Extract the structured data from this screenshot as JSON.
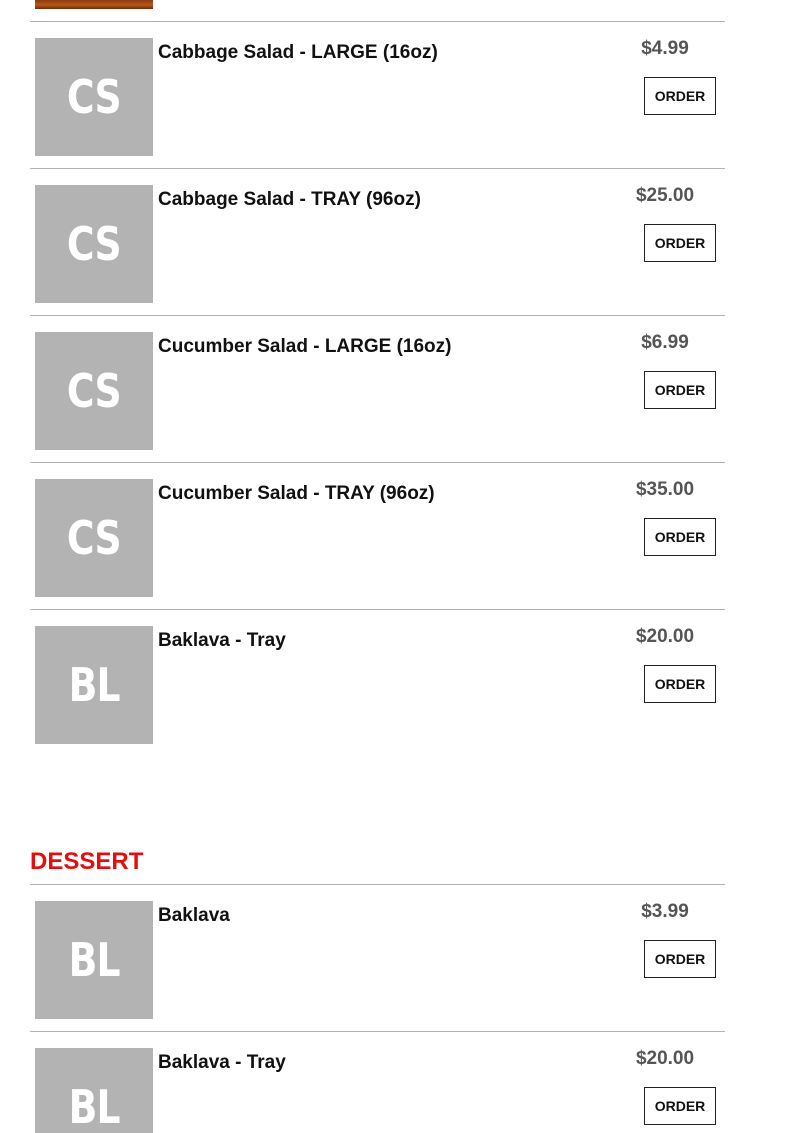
{
  "order_label": "ORDER",
  "salads": [
    {
      "initials": "CS",
      "name": "Cabbage Salad - LARGE (16oz)",
      "price": "$4.99"
    },
    {
      "initials": "CS",
      "name": "Cabbage Salad - TRAY (96oz)",
      "price": "$25.00"
    },
    {
      "initials": "CS",
      "name": "Cucumber Salad - LARGE (16oz)",
      "price": "$6.99"
    },
    {
      "initials": "CS",
      "name": "Cucumber Salad - TRAY (96oz)",
      "price": "$35.00"
    },
    {
      "initials": "BL",
      "name": "Baklava - Tray",
      "price": "$20.00"
    }
  ],
  "dessert": {
    "heading": "DESSERT",
    "items": [
      {
        "initials": "BL",
        "name": "Baklava",
        "price": "$3.99"
      },
      {
        "initials": "BL",
        "name": "Baklava - Tray",
        "price": "$20.00"
      }
    ]
  },
  "colors": {
    "heading": "#e30f0f",
    "thumb_bg": "#b3b3b3",
    "divider": "#b3b3b3"
  }
}
